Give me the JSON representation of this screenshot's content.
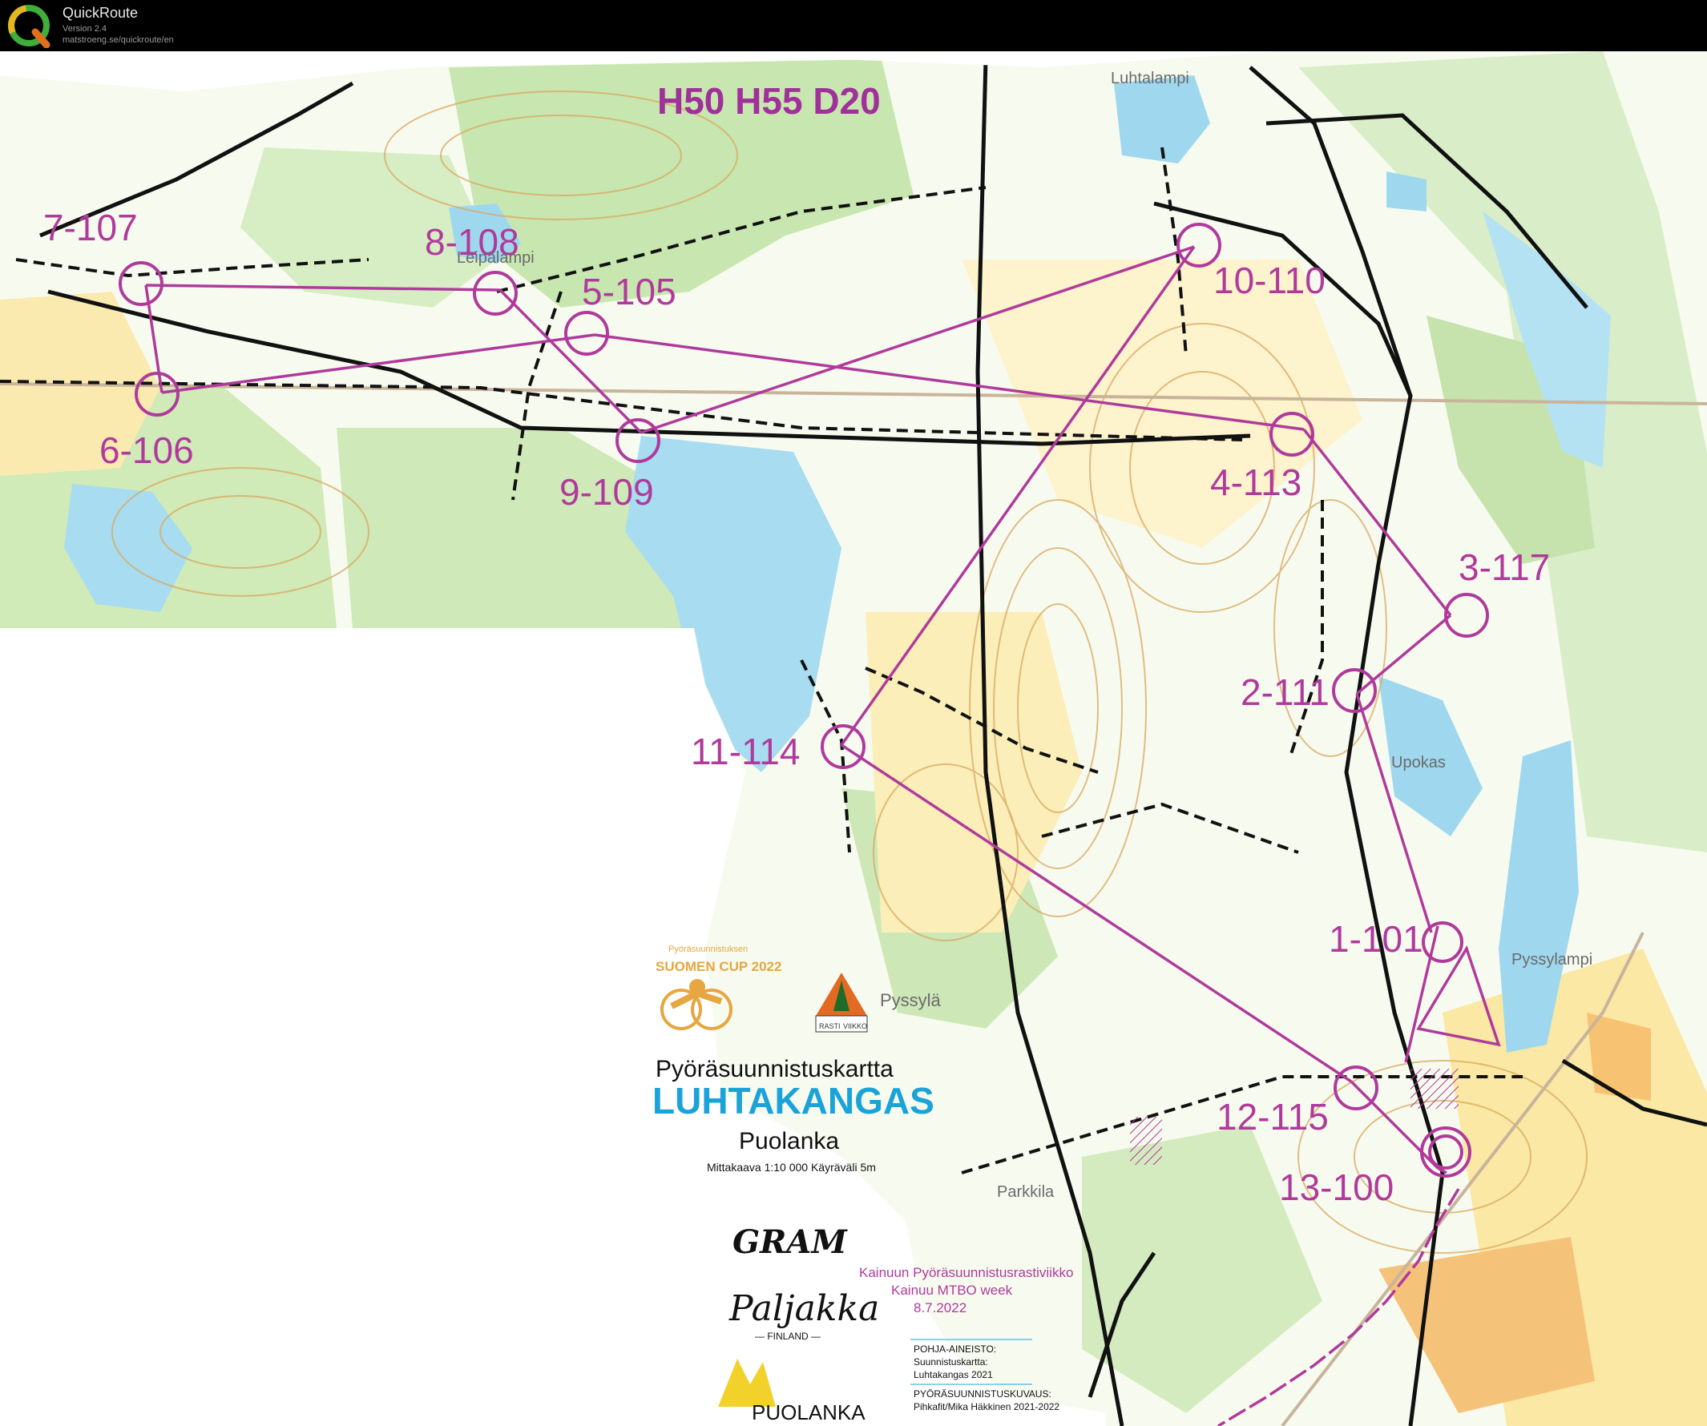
{
  "app": {
    "title": "QuickRoute",
    "version": "Version 2.4",
    "url": "matstroeng.se/quickroute/en",
    "logo_letter": "Q"
  },
  "map": {
    "course_classes": "H50 H55 D20",
    "controls": [
      {
        "id": "c1",
        "label": "1-101"
      },
      {
        "id": "c2",
        "label": "2-111"
      },
      {
        "id": "c3",
        "label": "3-117"
      },
      {
        "id": "c4",
        "label": "4-113"
      },
      {
        "id": "c5",
        "label": "5-105"
      },
      {
        "id": "c6",
        "label": "6-106"
      },
      {
        "id": "c7",
        "label": "7-107"
      },
      {
        "id": "c8",
        "label": "8-108"
      },
      {
        "id": "c9",
        "label": "9-109"
      },
      {
        "id": "c10",
        "label": "10-110"
      },
      {
        "id": "c11",
        "label": "11-114"
      },
      {
        "id": "c12",
        "label": "12-115"
      },
      {
        "id": "c13",
        "label": "13-100"
      }
    ],
    "place_names": {
      "luhtalampi": "Luhtalampi",
      "leipalampi": "Leipälampi",
      "upokas": "Upokas",
      "pyssylampi": "Pyssylampi",
      "parkkila": "Parkkila",
      "pyssyla": "Pyssylä"
    },
    "legend": {
      "map_type": "Pyöräsuunnistuskartta",
      "map_name": "LUHTAKANGAS",
      "municipality": "Puolanka",
      "scale_info": "Mittakaava 1:10 000   Käyräväli 5m",
      "event_line1": "Kainuun Pyöräsuunnistusrastiviikko",
      "event_line2": "Kainuu MTBO week",
      "event_date": "8.7.2022",
      "base_title": "POHJA-AINEISTO:",
      "base_line1": "Suunnistuskartta:",
      "base_line2": "Luhtakangas 2021",
      "survey_title": "PYÖRÄSUUNNISTUSKUVAUS:",
      "survey_line": "Pihkafit/Mika Häkkinen 2021-2022"
    },
    "sponsors": {
      "cup_small": "Pyöräsuunnistuksen",
      "cup_name": "SUOMEN CUP 2022",
      "gram": "GRAM",
      "paljakka": "Paljakka",
      "paljakka_sub": "— FINLAND —",
      "puolanka": "PUOLANKA",
      "rasti_top": "RASTI",
      "rasti_bottom": "VIIKKO"
    },
    "colors": {
      "course": "#b03a9c",
      "water": "#9fd8ee",
      "open_yellow": "#fbe9a2",
      "green": "#c8e6b0",
      "contour": "#d9a860",
      "track": "#111111"
    }
  }
}
